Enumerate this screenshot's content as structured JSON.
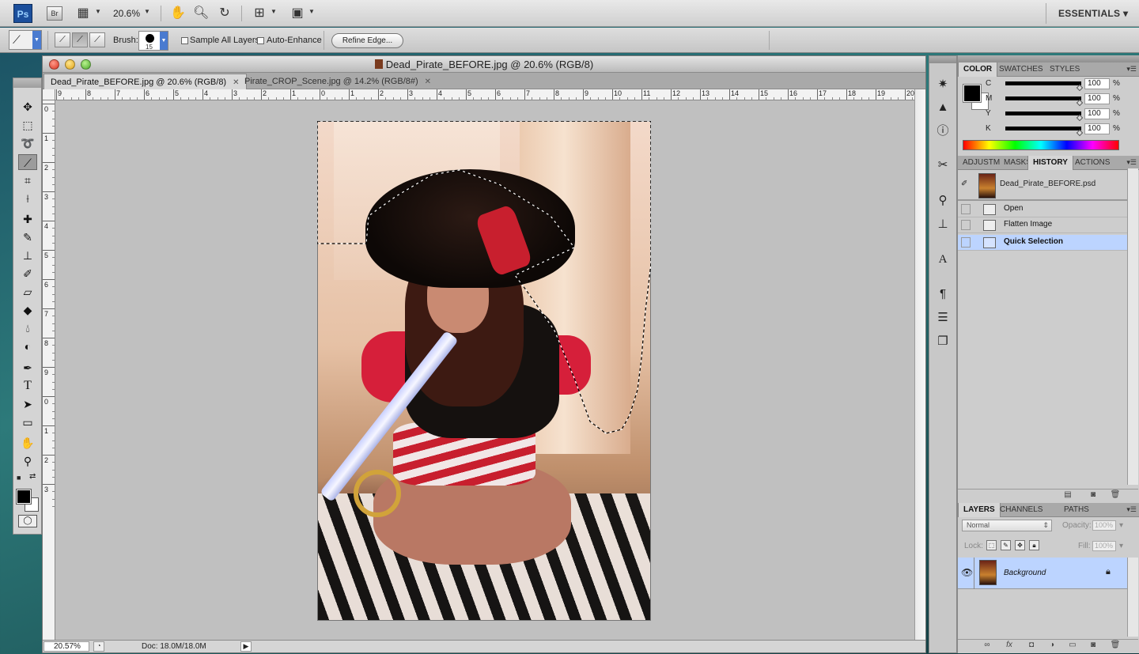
{
  "app_bar": {
    "ps_logo": "Ps",
    "br_logo": "Br",
    "zoom": "20.6%",
    "workspace": "ESSENTIALS ▾"
  },
  "options_bar": {
    "brush_label": "Brush:",
    "brush_size": "15",
    "sample_all_layers": "Sample All Layers",
    "auto_enhance": "Auto-Enhance",
    "refine_edge": "Refine Edge..."
  },
  "document": {
    "window_title": "Dead_Pirate_BEFORE.jpg @ 20.6% (RGB/8)",
    "tabs": [
      {
        "label": "Dead_Pirate_BEFORE.jpg @ 20.6% (RGB/8)",
        "close": "✕"
      },
      {
        "label": "Pirate_CROP_Scene.jpg @ 14.2% (RGB/8#)",
        "close": "✕"
      }
    ],
    "ruler_h": [
      "9",
      "8",
      "7",
      "6",
      "5",
      "4",
      "3",
      "2",
      "1",
      "0",
      "1",
      "2",
      "3",
      "4",
      "5",
      "6",
      "7",
      "8",
      "9",
      "10",
      "11",
      "12",
      "13",
      "14",
      "15",
      "16",
      "17",
      "18",
      "19",
      "20"
    ],
    "ruler_v": [
      "0",
      "1",
      "2",
      "3",
      "4",
      "5",
      "6",
      "7",
      "8",
      "9",
      "0",
      "1",
      "2",
      "3"
    ],
    "status_zoom": "20.57%",
    "status_doc": "Doc: 18.0M/18.0M"
  },
  "color_panel": {
    "tabs": [
      "COLOR",
      "SWATCHES",
      "STYLES"
    ],
    "sliders": [
      {
        "label": "C",
        "value": "100"
      },
      {
        "label": "M",
        "value": "100"
      },
      {
        "label": "Y",
        "value": "100"
      },
      {
        "label": "K",
        "value": "100"
      }
    ],
    "percent": "%"
  },
  "history_panel": {
    "tabs": [
      "ADJUSTM",
      "MASKS",
      "HISTORY",
      "ACTIONS"
    ],
    "snapshot": "Dead_Pirate_BEFORE.psd",
    "steps": [
      "Open",
      "Flatten Image",
      "Quick Selection"
    ]
  },
  "layers_panel": {
    "tabs": [
      "LAYERS",
      "CHANNELS",
      "PATHS"
    ],
    "blend_mode": "Normal",
    "opacity_label": "Opacity:",
    "opacity_value": "100%",
    "lock_label": "Lock:",
    "fill_label": "Fill:",
    "fill_value": "100%",
    "layer_name": "Background"
  },
  "colors": {
    "accent_selection": "#bcd4ff",
    "foreground": "#000000",
    "background": "#ffffff"
  }
}
